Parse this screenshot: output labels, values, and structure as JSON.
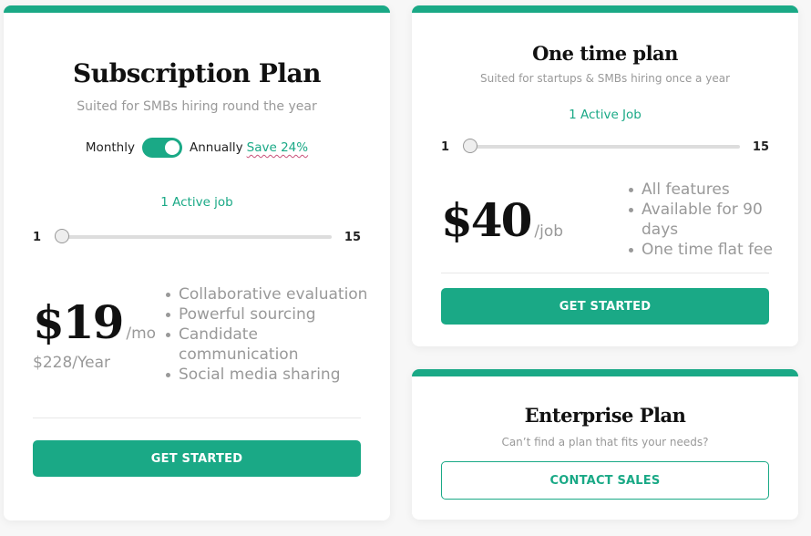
{
  "subscription": {
    "title": "Subscription Plan",
    "subtitle": "Suited for SMBs hiring round the year",
    "billing": {
      "monthly_label": "Monthly",
      "annually_label": "Annually",
      "save_label": "Save 24%",
      "toggle_state": "annually"
    },
    "jobs_label": "1 Active job",
    "slider": {
      "min": "1",
      "max": "15",
      "value": 1
    },
    "price": "$19",
    "per": "/mo",
    "yearly": "$228/Year",
    "features": [
      "Collaborative evaluation",
      "Powerful sourcing",
      "Candidate communication",
      "Social media sharing"
    ],
    "cta": "GET STARTED"
  },
  "one_time": {
    "title": "One time plan",
    "subtitle": "Suited for startups & SMBs hiring once a year",
    "jobs_label": "1 Active Job",
    "slider": {
      "min": "1",
      "max": "15",
      "value": 1
    },
    "price": "$40",
    "per": "/job",
    "features": [
      "All features",
      "Available for 90 days",
      "One time flat fee"
    ],
    "cta": "GET STARTED"
  },
  "enterprise": {
    "title": "Enterprise Plan",
    "subtitle": "Can’t find a plan that fits your needs?",
    "cta": "CONTACT SALES"
  },
  "colors": {
    "accent": "#1aa986",
    "muted_text": "#999999",
    "heading": "#111111"
  }
}
